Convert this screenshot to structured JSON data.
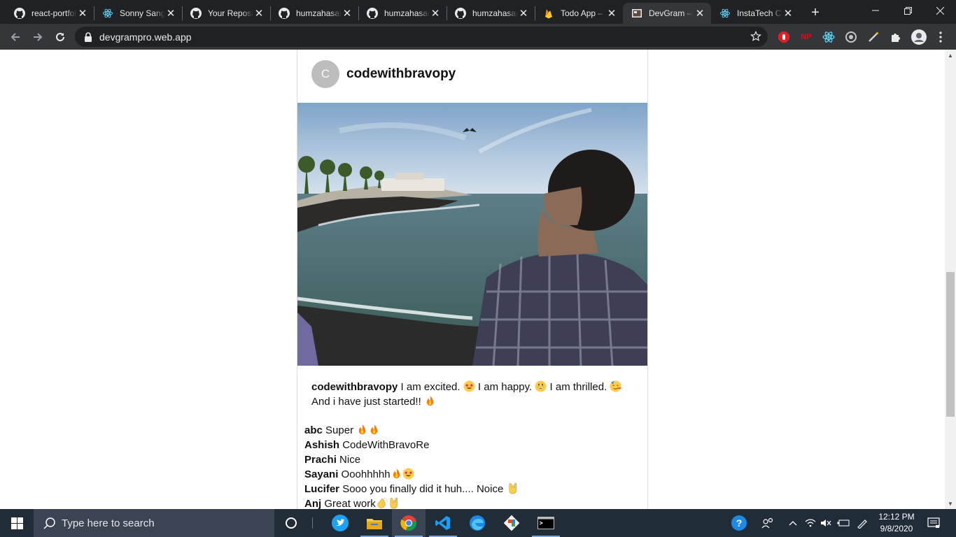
{
  "browser": {
    "tabs": [
      {
        "title": "react-portfolio",
        "icon": "github-icon"
      },
      {
        "title": "Sonny Sangha",
        "icon": "react-icon"
      },
      {
        "title": "Your Repositories",
        "icon": "github-icon"
      },
      {
        "title": "humzahasan",
        "icon": "github-icon"
      },
      {
        "title": "humzahasan",
        "icon": "github-icon"
      },
      {
        "title": "humzahasan",
        "icon": "github-icon"
      },
      {
        "title": "Todo App – Firebase",
        "icon": "firebase-icon"
      },
      {
        "title": "DevGram – DevGram",
        "icon": "devgram-icon",
        "active": true
      },
      {
        "title": "InstaTech Clone",
        "icon": "react-icon"
      }
    ],
    "url": "devgrampro.web.app",
    "extensions": [
      "red-hand-extension-icon",
      "netflix-party-extension-icon",
      "react-devtools-icon",
      "circle-extension-icon",
      "pen-extension-icon",
      "puzzle-extensions-icon",
      "profile-avatar-icon"
    ]
  },
  "post": {
    "avatar_letter": "C",
    "username": "codewithbravopy",
    "caption": {
      "username": "codewithbravopy",
      "segments": [
        {
          "text": " I am excited. ",
          "emoji": "star-struck-emoji"
        },
        {
          "text": " I am happy. ",
          "emoji": "grinning-emoji"
        },
        {
          "text": " I am thrilled. ",
          "emoji": "party-face-emoji"
        },
        {
          "text": " And i have just started!! ",
          "emoji": "fire-emoji"
        }
      ]
    },
    "comments": [
      {
        "user": "abc",
        "text": "Super ",
        "emojis": [
          "fire-emoji",
          "fire-emoji"
        ]
      },
      {
        "user": "Ashish",
        "text": "CodeWithBravoRe",
        "emojis": []
      },
      {
        "user": "Prachi",
        "text": "Nice",
        "emojis": []
      },
      {
        "user": "Sayani",
        "text": "Ooohhhhh",
        "emojis": [
          "fire-emoji",
          "star-struck-emoji"
        ]
      },
      {
        "user": "Lucifer",
        "text": "Sooo you finally did it huh.... Noice ",
        "emojis": [
          "rock-hand-emoji"
        ]
      },
      {
        "user": "Anj",
        "text": "Great work",
        "emojis": [
          "clap-emoji",
          "rock-hand-emoji"
        ]
      }
    ]
  },
  "taskbar": {
    "search_placeholder": "Type here to search",
    "pinned": [
      "cortana-icon",
      "twitter-icon",
      "file-explorer-icon",
      "chrome-icon",
      "vscode-icon",
      "edge-icon",
      "git-icon",
      "terminal-icon"
    ],
    "time": "12:12 PM",
    "date": "9/8/2020"
  },
  "colors": {
    "tab_strip": "#202124",
    "toolbar": "#35363a",
    "taskbar": "#202c38",
    "fire": "#ff7a00",
    "emoji_yellow": "#ffcc4d"
  }
}
